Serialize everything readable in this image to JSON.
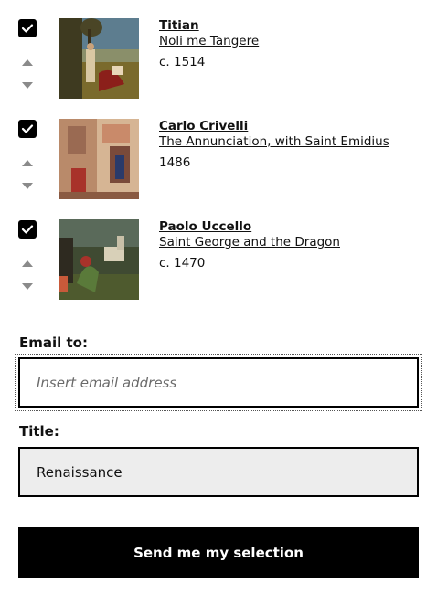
{
  "items": [
    {
      "artist": "Titian",
      "title": "Noli me Tangere",
      "date": "c. 1514",
      "checked": true
    },
    {
      "artist": "Carlo Crivelli",
      "title": "The Annunciation, with Saint Emidius",
      "date": "1486",
      "checked": true
    },
    {
      "artist": "Paolo Uccello",
      "title": "Saint George and the Dragon",
      "date": "c. 1470",
      "checked": true
    }
  ],
  "form": {
    "email_label": "Email to:",
    "email_placeholder": "Insert email address",
    "email_value": "",
    "title_label": "Title:",
    "title_value": "Renaissance",
    "submit_label": "Send me my selection"
  },
  "icons": {
    "checkbox": "check-icon",
    "move_up": "caret-up-icon",
    "move_down": "caret-down-icon"
  }
}
